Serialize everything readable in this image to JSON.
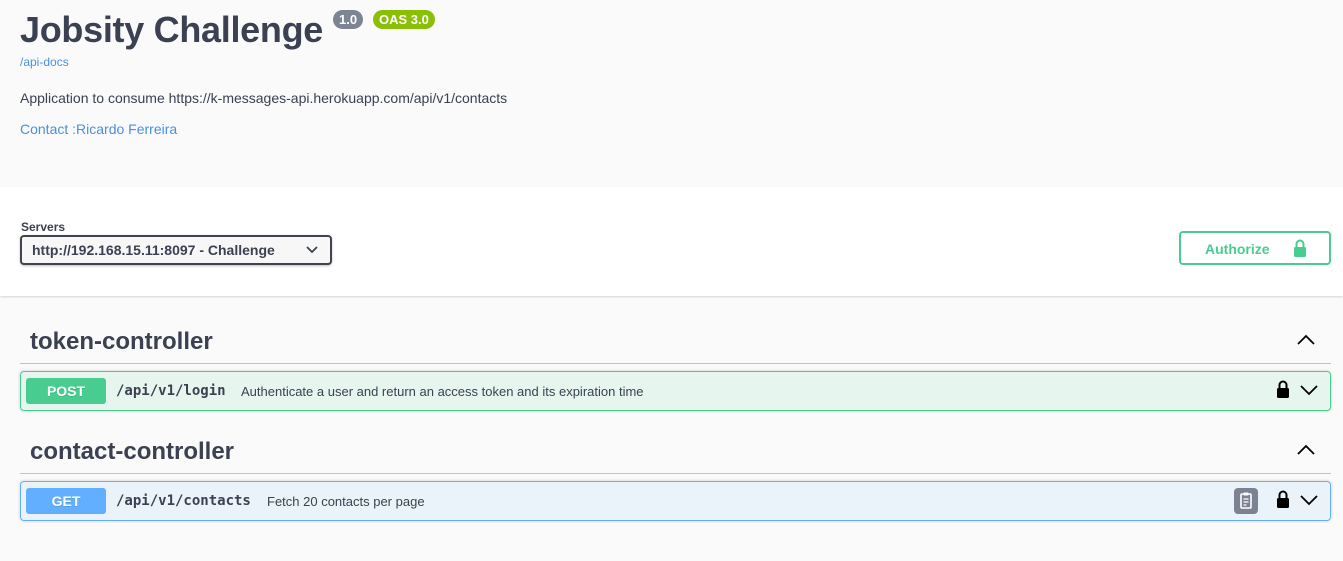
{
  "info": {
    "title": "Jobsity Challenge",
    "version_badge": "1.0",
    "oas_badge": "OAS 3.0",
    "url": "/api-docs",
    "description": "Application to consume https://k-messages-api.herokuapp.com/api/v1/contacts",
    "contact": "Contact :Ricardo Ferreira"
  },
  "servers": {
    "label": "Servers",
    "selected": "http://192.168.15.11:8097 - Challenge"
  },
  "authorize": {
    "label": "Authorize",
    "icon": "lock-icon"
  },
  "tags": [
    {
      "name": "token-controller",
      "operations": [
        {
          "method": "POST",
          "path": "/api/v1/login",
          "summary": "Authenticate a user and return an access token and its expiration time"
        }
      ]
    },
    {
      "name": "contact-controller",
      "operations": [
        {
          "method": "GET",
          "path": "/api/v1/contacts",
          "summary": "Fetch 20 contacts per page"
        }
      ]
    }
  ],
  "colors": {
    "post": "#49cc90",
    "get": "#61affe",
    "link": "#4990e2",
    "text": "#3b4151"
  }
}
